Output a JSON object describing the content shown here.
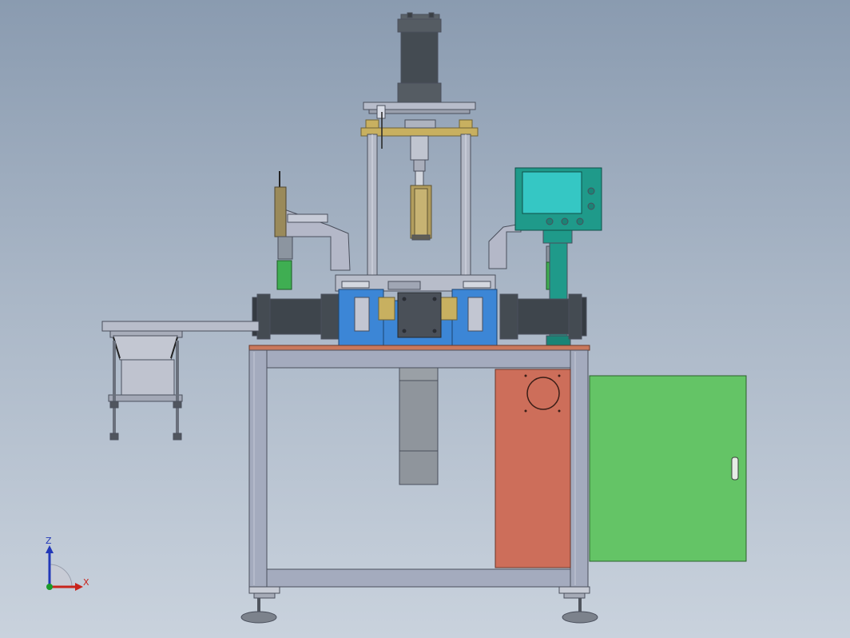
{
  "colors": {
    "background_top": "#8a9bb0",
    "background_bottom": "#c9d2dd",
    "frame": "#a4abbe",
    "frame_edge": "#4a4f5c",
    "tabletop": "#c9785c",
    "cabinet_door": "#64c466",
    "electric_box": "#cd6e5a",
    "panel_housing": "#1f9a8a",
    "panel_screen": "#35c7c4",
    "cylinder_dark": "#444b52",
    "fixture_blue": "#3c86d6",
    "brass": "#c8b060",
    "sensor_green": "#3fae52"
  },
  "triad": {
    "z_label": "Z",
    "x_label": "X",
    "z_color": "#2238b8",
    "x_color": "#c8241c",
    "y_color": "#1a9a2a"
  }
}
